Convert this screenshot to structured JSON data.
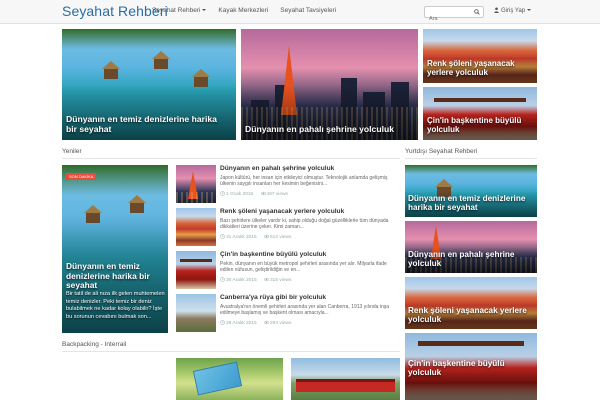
{
  "nav": {
    "brand": "Seyahat Rehberi",
    "menu": [
      "Seyahat Rehberi",
      "Kayak Merkezleri",
      "Seyahat Tavsiyeleri"
    ],
    "search_placeholder": "Ara",
    "login": "Giriş Yap"
  },
  "hero": [
    {
      "title": "Dünyanın en temiz denizlerine harika bir seyahat",
      "scene": "overwater-bungalows"
    },
    {
      "title": "Dünyanın en pahalı şehrine yolculuk",
      "scene": "tokyo-tower-skyline"
    },
    {
      "title": "Renk şöleni yaşanacak yerlere yolculuk",
      "scene": "rainbow-mountains"
    },
    {
      "title": "Çin'in başkentine büyülü yolculuk",
      "scene": "tiananmen-gate"
    }
  ],
  "sections": {
    "latest": "Yeniler",
    "sidebar": "Yurtdışı Seyahat Rehberi",
    "backpacking": "Backpacking - Interrail"
  },
  "featured": {
    "badge": "SON DAKİKA",
    "title": "Dünyanın en temiz denizlerine harika bir seyahat",
    "excerpt": "Bir tatil de ali nıza ilk gelen muhtemelen temiz denizler. Peki temiz bir deniz bulabilmek ne kadar kolay olabilir? İşte bu sorunun cevabını bulmak son..."
  },
  "list": [
    {
      "title": "Dünyanın en pahalı şehrine yolculuk",
      "excerpt": "Japon kültürü, her insan için etkileyici olmuştur. Teknolojik anlamda gelişmiş ülkenin saygılı insanları her kesimin beğenisini...",
      "date": "1 Ocak 2016",
      "views": "467 views",
      "scene": "tokyo-tower-skyline"
    },
    {
      "title": "Renk şöleni yaşanacak yerlere yolculuk",
      "excerpt": "Bazı şehirlere ülkeler vardır ki, sahip olduğu doğal güzelliklerle tüm dünyada dikkatleri üzerine çeker. Kimi zaman...",
      "date": "31 Aralık 2015",
      "views": "512 views",
      "scene": "rainbow-mountains"
    },
    {
      "title": "Çin'in başkentine büyülü yolculuk",
      "excerpt": "Pekin, dünyanın en büyük metropol şehirleri arasında yer alır. Milyarla ifade edilen nüfusun, geliştirildiğin ve en...",
      "date": "30 Aralık 2015",
      "views": "315 views",
      "scene": "tiananmen-gate"
    },
    {
      "title": "Canberra'ya rüya gibi bir yolculuk",
      "excerpt": "Avustralya'nın önemli şehirleri arasında yer alan Canberra, 1913 yılında inşa edilmeye başlamış ve başkent olması amacıyla...",
      "date": "29 Aralık 2015",
      "views": "294 views",
      "scene": "canberra-city"
    }
  ],
  "sidebar": [
    {
      "title": "Dünyanın en temiz denizlerine harika bir seyahat",
      "scene": "overwater-bungalows"
    },
    {
      "title": "Dünyanın en pahalı şehrine yolculuk",
      "scene": "tokyo-tower-skyline"
    },
    {
      "title": "Renk şöleni yaşanacak yerlere yolculuk",
      "scene": "rainbow-mountains"
    },
    {
      "title": "Çin'in başkentine büyülü yolculuk",
      "scene": "tiananmen-gate"
    }
  ],
  "icons": [
    "search-icon",
    "user-icon",
    "clock-icon",
    "eye-icon",
    "caret-down-icon"
  ],
  "colors": {
    "brand": "#2b6ca3",
    "badge": "#e74c3c",
    "navbar": "#f7f7f7"
  }
}
